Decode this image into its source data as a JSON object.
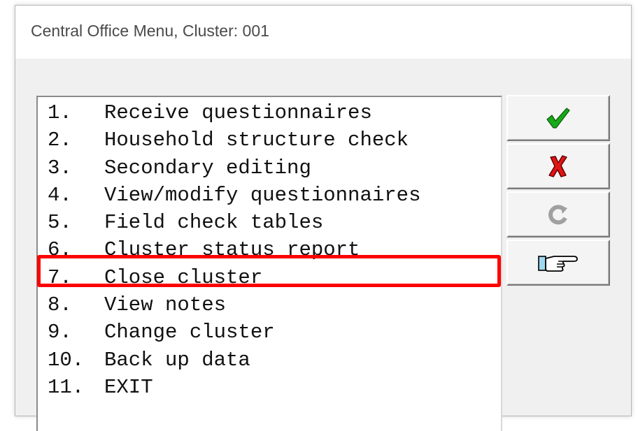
{
  "window": {
    "title": "Central Office Menu, Cluster: 001"
  },
  "menu": {
    "items": [
      {
        "num": "1.",
        "label": "Receive questionnaires"
      },
      {
        "num": "2.",
        "label": "Household structure check"
      },
      {
        "num": "3.",
        "label": "Secondary editing"
      },
      {
        "num": "4.",
        "label": "View/modify questionnaires"
      },
      {
        "num": "5.",
        "label": "Field check tables"
      },
      {
        "num": "6.",
        "label": "Cluster status report"
      },
      {
        "num": "7.",
        "label": "Close cluster"
      },
      {
        "num": "8.",
        "label": "View notes"
      },
      {
        "num": "9.",
        "label": "Change cluster"
      },
      {
        "num": "10.",
        "label": "Back up data"
      },
      {
        "num": "11.",
        "label": "EXIT"
      }
    ],
    "highlighted_item": "7. Close cluster"
  },
  "toolbar": {
    "buttons": [
      {
        "icon": "checkmark-icon",
        "color": "#18a818"
      },
      {
        "icon": "x-icon",
        "color": "#e21414"
      },
      {
        "icon": "refresh-icon",
        "color": "#a0a0a0"
      },
      {
        "icon": "pointing-hand-icon",
        "color": "#000000"
      }
    ]
  },
  "colors": {
    "highlight": "#ff0000",
    "window_bg": "#f0f0f0",
    "titlebar_bg": "#ffffff"
  }
}
